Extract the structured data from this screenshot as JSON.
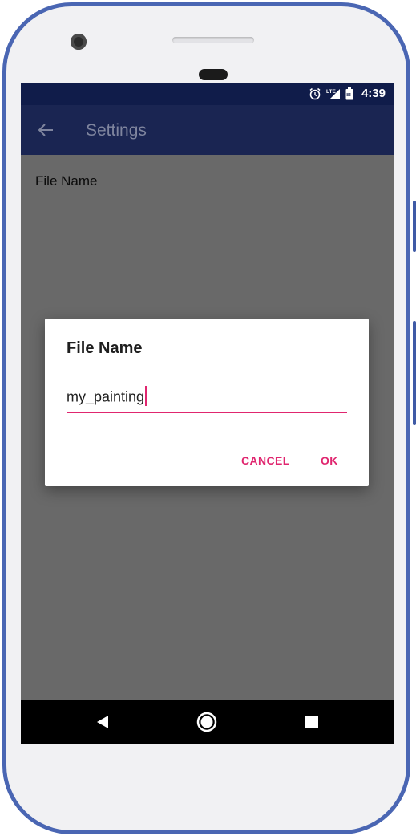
{
  "status_bar": {
    "time": "4:39",
    "icons": [
      "alarm-icon",
      "lte-signal-icon",
      "battery-icon"
    ],
    "network_label": "LTE"
  },
  "app_bar": {
    "title": "Settings",
    "back_icon": "arrow-left-icon"
  },
  "settings": {
    "items": [
      {
        "label": "File Name"
      }
    ]
  },
  "dialog": {
    "title": "File Name",
    "input_value": "my_painting",
    "cancel_label": "CANCEL",
    "ok_label": "OK"
  },
  "nav_bar": {
    "icons": [
      "back-triangle-icon",
      "home-circle-icon",
      "recents-square-icon"
    ]
  },
  "colors": {
    "accent": "#e0266f",
    "primary_dark": "#101c4a",
    "primary": "#1a2552",
    "scrim_background": "#696969",
    "frame": "#4a66b3"
  }
}
